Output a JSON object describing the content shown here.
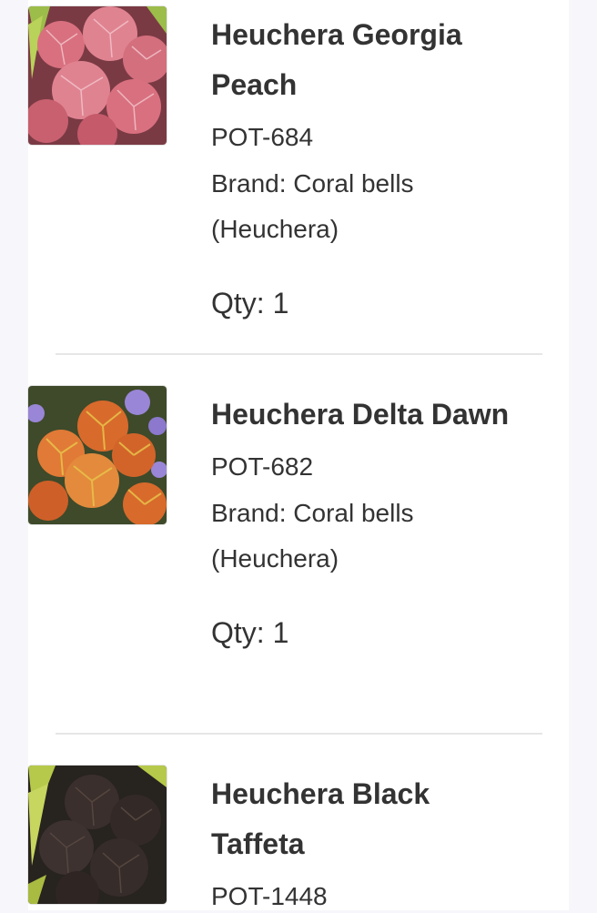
{
  "cart": {
    "items": [
      {
        "name": "Heuchera Georgia Peach",
        "sku": "POT-684",
        "brand": "Brand: Coral bells (Heuchera)",
        "qty": "Qty: 1",
        "image_colors": {
          "bg": "#7a3a44",
          "leaf": "#d9707f",
          "vein": "#f3c9cf",
          "accent": "#9cbd4a"
        }
      },
      {
        "name": "Heuchera Delta Dawn",
        "sku": "POT-682",
        "brand": "Brand: Coral bells (Heuchera)",
        "qty": "Qty: 1",
        "image_colors": {
          "bg": "#3e4a2a",
          "leaf": "#d86a2c",
          "vein": "#e8c34a",
          "accent": "#9a86d6"
        }
      },
      {
        "name": "Heuchera Black Taffeta",
        "sku": "POT-1448",
        "brand": "",
        "qty": "",
        "image_colors": {
          "bg": "#27231f",
          "leaf": "#3a2f2c",
          "vein": "#56463f",
          "accent": "#b7c94a"
        }
      }
    ]
  }
}
